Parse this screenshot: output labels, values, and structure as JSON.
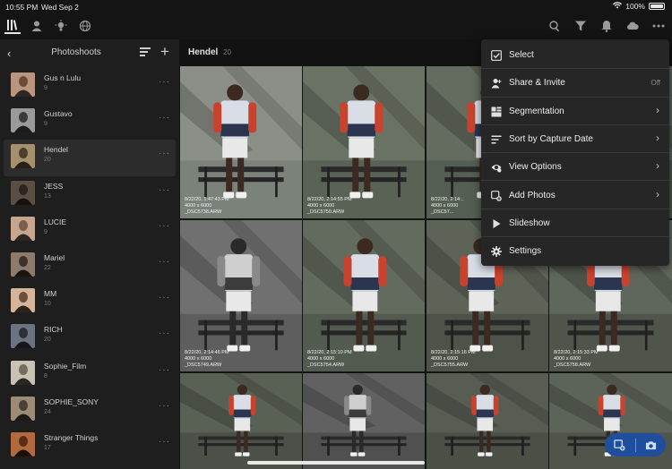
{
  "status_bar": {
    "time": "10:55 PM",
    "date": "Wed Sep 2",
    "battery": "100%"
  },
  "toolbar": {
    "left_icons": [
      "library-icon",
      "people-icon",
      "learn-icon",
      "community-icon"
    ],
    "right_icons": [
      "search-icon",
      "filter-icon",
      "notifications-icon",
      "cloud-icon",
      "more-icon"
    ]
  },
  "sidebar": {
    "title": "Photoshoots",
    "items": [
      {
        "name": "Gus n Lulu",
        "count": "9"
      },
      {
        "name": "Gustavo",
        "count": "9"
      },
      {
        "name": "Hendel",
        "count": "20"
      },
      {
        "name": "JESS",
        "count": "13"
      },
      {
        "name": "LUCIE",
        "count": "9"
      },
      {
        "name": "Mariel",
        "count": "22"
      },
      {
        "name": "MM",
        "count": "10"
      },
      {
        "name": "RICH",
        "count": "20"
      },
      {
        "name": "Sophie_Film",
        "count": "8"
      },
      {
        "name": "SOPHIE_SONY",
        "count": "24"
      },
      {
        "name": "Stranger Things",
        "count": "17"
      }
    ],
    "selected_index": 2
  },
  "album": {
    "title": "Hendel",
    "count": "20"
  },
  "photos": [
    {
      "date": "8/22/20, 1:47:43 PM",
      "size": "4000 x 6000",
      "file": "_DSC5738.ARW"
    },
    {
      "date": "8/22/20, 2:14:55 PM",
      "size": "4000 x 6000",
      "file": "_DSC5750.ARW"
    },
    {
      "date": "8/22/20, 2:14:..",
      "size": "4000 x 6000",
      "file": "_DSC57..."
    },
    {
      "date": "8/22/20, 2:14:46 PM",
      "size": "4000 x 6000",
      "file": "_DSC5749.ARW"
    },
    {
      "date": "8/22/20, 2:15:10 PM",
      "size": "4000 x 6000",
      "file": "_DSC5754.ARW"
    },
    {
      "date": "8/22/20, 2:15:16 PM",
      "size": "4000 x 6000",
      "file": "_DSC5755.ARW"
    },
    {
      "date": "8/22/20, 2:15:33 PM",
      "size": "4000 x 6000",
      "file": "_DSC5758.ARW"
    }
  ],
  "menu": {
    "items": [
      {
        "label": "Select",
        "icon": "select-icon",
        "value": "",
        "chevron": ""
      },
      {
        "label": "Share & Invite",
        "icon": "share-icon",
        "value": "Off",
        "chevron": ""
      },
      {
        "label": "Segmentation",
        "icon": "segmentation-icon",
        "value": "",
        "chevron": "›"
      },
      {
        "label": "Sort by Capture Date",
        "icon": "sort-icon",
        "value": "",
        "chevron": "›"
      },
      {
        "label": "View Options",
        "icon": "view-options-icon",
        "value": "",
        "chevron": "›"
      },
      {
        "label": "Add Photos",
        "icon": "add-photos-icon",
        "value": "",
        "chevron": "›"
      },
      {
        "label": "Slideshow",
        "icon": "slideshow-icon",
        "value": "",
        "chevron": ""
      },
      {
        "label": "Settings",
        "icon": "settings-icon",
        "value": "",
        "chevron": ""
      }
    ]
  },
  "colors": {
    "accent": "#1f4f9c",
    "menu_bg": "#262626",
    "sidebar_bg": "#1e1e1e"
  }
}
